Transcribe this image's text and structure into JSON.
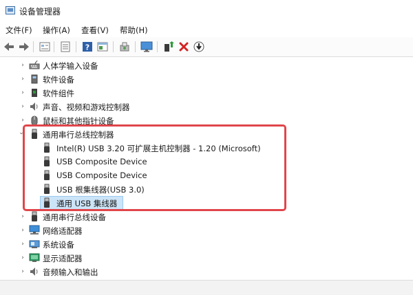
{
  "window": {
    "title": "设备管理器"
  },
  "menu": [
    {
      "label": "文件(F)"
    },
    {
      "label": "操作(A)"
    },
    {
      "label": "查看(V)"
    },
    {
      "label": "帮助(H)"
    }
  ],
  "toolbar": {
    "icons": [
      "back-arrow-icon",
      "forward-arrow-icon",
      "properties-icon",
      "device-list-icon",
      "help-icon",
      "view-icon",
      "scan-hardware-icon",
      "monitor-icon",
      "update-driver-icon",
      "uninstall-icon",
      "disable-device-icon"
    ]
  },
  "tree": {
    "categories_top": [
      {
        "label": "人体学输入设备",
        "icon": "hid-icon"
      },
      {
        "label": "软件设备",
        "icon": "software-device-icon"
      },
      {
        "label": "软件组件",
        "icon": "software-component-icon"
      },
      {
        "label": "声音、视频和游戏控制器",
        "icon": "speaker-icon"
      },
      {
        "label": "鼠标和其他指针设备",
        "icon": "mouse-icon"
      }
    ],
    "expanded_category": {
      "label": "通用串行总线控制器",
      "icon": "usb-icon",
      "expanded_glyph": "⌄"
    },
    "children": [
      {
        "label": "Intel(R) USB 3.20 可扩展主机控制器 - 1.20 (Microsoft)",
        "icon": "usb-icon"
      },
      {
        "label": "USB Composite Device",
        "icon": "usb-icon"
      },
      {
        "label": "USB Composite Device",
        "icon": "usb-icon"
      },
      {
        "label": "USB 根集线器(USB 3.0)",
        "icon": "usb-icon"
      },
      {
        "label": "通用 USB 集线器",
        "icon": "usb-icon",
        "selected": true
      }
    ],
    "categories_bottom": [
      {
        "label": "通用串行总线设备",
        "icon": "usb-icon"
      },
      {
        "label": "网络适配器",
        "icon": "network-icon"
      },
      {
        "label": "系统设备",
        "icon": "system-icon"
      },
      {
        "label": "显示适配器",
        "icon": "display-icon"
      },
      {
        "label": "音频输入和输出",
        "icon": "speaker-icon"
      }
    ],
    "collapsed_glyph": "›"
  },
  "colors": {
    "highlight_border": "#e0454a",
    "selection_bg": "#cce4f7"
  }
}
